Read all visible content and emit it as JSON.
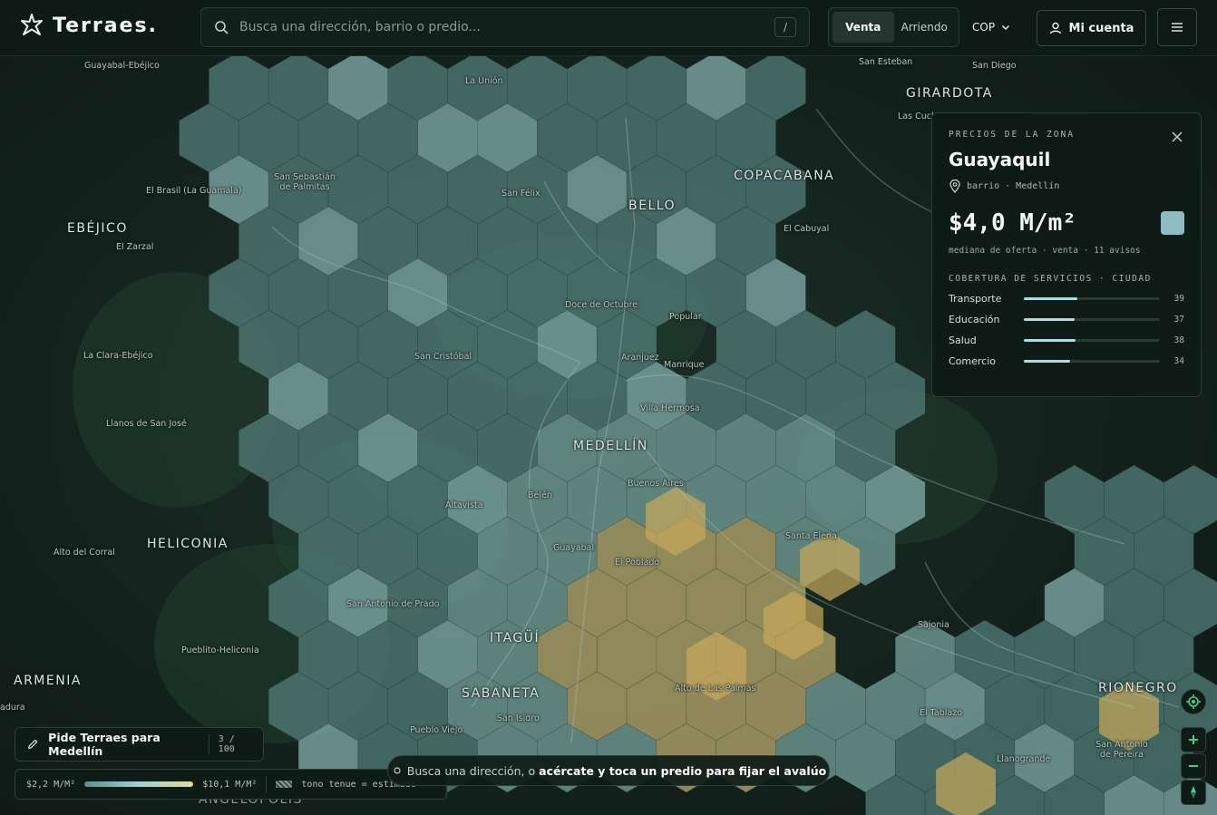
{
  "app": {
    "brand": "Terraes."
  },
  "search": {
    "placeholder": "Busca una dirección, barrio o predio...",
    "shortcut": "/"
  },
  "mode_toggle": {
    "options": [
      "Venta",
      "Arriendo"
    ],
    "active": "Venta"
  },
  "currency": {
    "label": "COP"
  },
  "account": {
    "label": "Mi cuenta"
  },
  "zone_card": {
    "kicker": "PRECIOS DE LA ZONA",
    "title": "Guayaquil",
    "subtitle": "barrio · Medellín",
    "price": "$4,0 M/m²",
    "price_note": "mediana de oferta · venta · 11 avisos",
    "swatch_color": "#8fbcc0",
    "services_header": "COBERTURA DE SERVICIOS · CIUDAD",
    "services": [
      {
        "label": "Transporte",
        "value": "39",
        "fraction": 0.39
      },
      {
        "label": "Educación",
        "value": "37",
        "fraction": 0.37
      },
      {
        "label": "Salud",
        "value": "38",
        "fraction": 0.38
      },
      {
        "label": "Comercio",
        "value": "34",
        "fraction": 0.34
      }
    ]
  },
  "ask": {
    "label": "Pide Terraes para Medellín",
    "count": "3 / 100"
  },
  "legend": {
    "min": "$2,2 M/M²",
    "max": "$10,1 M/M²",
    "estimated_note": "tono tenue = estimado"
  },
  "hint": {
    "prefix": "Busca una dirección, o",
    "emphasis": "acércate y toca un predio para fijar el avalúo"
  },
  "colors": {
    "accent": "#a9dde4",
    "hex_low": "#5e8f8a",
    "hex_high": "#d9c27a",
    "background": "#0f1c18"
  },
  "places": {
    "big": [
      "EBÉJICO",
      "HELICONIA",
      "ARMENIA",
      "BELLO",
      "COPACABANA",
      "GIRARDOTA",
      "MEDELLÍN",
      "ITAGÜÍ",
      "SABANETA",
      "RIONEGRO",
      "ANGELÓPOLIS"
    ],
    "small": [
      "Guayabal-Ebéjico",
      "La Unión",
      "San Esteban",
      "San Diego",
      "Las Cuch",
      "San Sebastián de Palmitas",
      "El Brasil (La Guamala)",
      "San Félix",
      "El Zarzal",
      "El Cabuyal",
      "Doce de Octubre",
      "Popular",
      "San Cristóbal",
      "La Clara-Ebéjico",
      "Aranjuez",
      "Manrique",
      "Villa Hermosa",
      "Llanos de San José",
      "Buenos Aires",
      "Belén",
      "Altavista",
      "Santa Elena",
      "Alto del Corral",
      "Guayabal",
      "El Poblado",
      "San Antonio de Prado",
      "Sajonia",
      "Pueblito-Heliconia",
      "Alto de Las Palmas",
      "El Tablazo",
      "San Isidro",
      "Pueblo Viejo",
      "Llanogrande",
      "San Antonio de Pereira",
      "adura"
    ]
  }
}
